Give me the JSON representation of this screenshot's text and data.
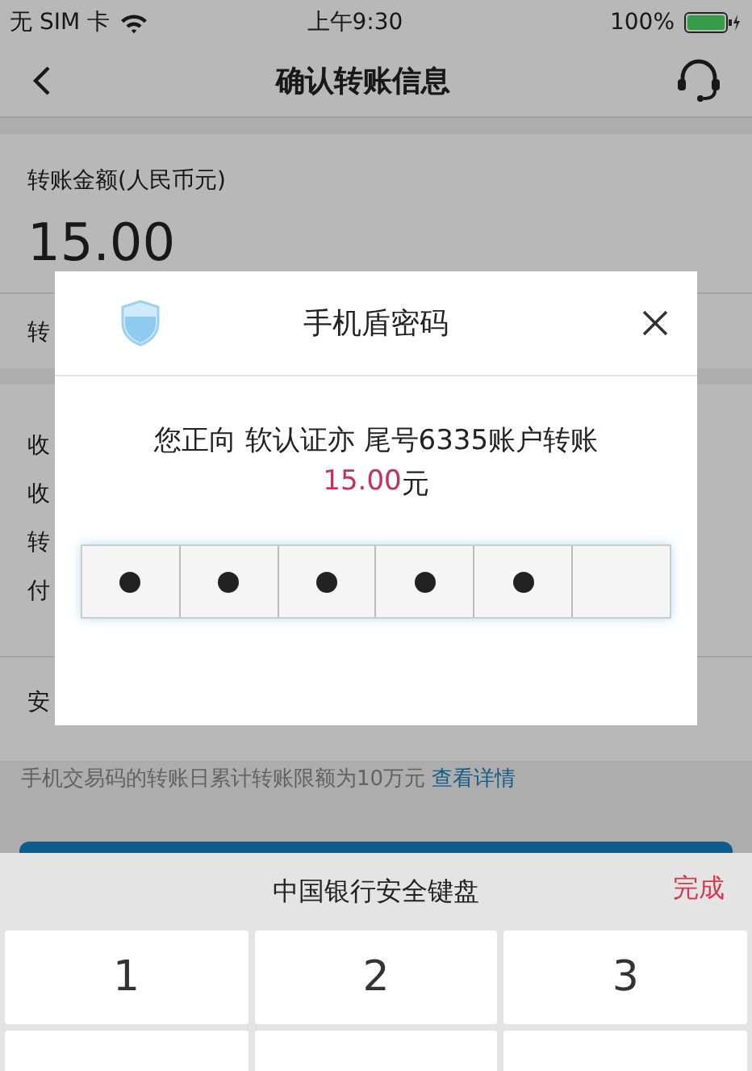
{
  "status_bar": {
    "carrier": "无 SIM 卡",
    "time": "上午9:30",
    "battery": "100%"
  },
  "nav": {
    "title": "确认转账信息"
  },
  "amount": {
    "label": "转账金额(人民币元)",
    "value": "15.00"
  },
  "section_1": [
    "转"
  ],
  "section_2": [
    "收",
    "收",
    "转",
    "付"
  ],
  "section_3": [
    "安"
  ],
  "note": {
    "text": "手机交易码的转账日累计转账限额为10万元",
    "link": "查看详情"
  },
  "dialog": {
    "title": "手机盾密码",
    "message": "您正向 软认证亦 尾号6335账户转账",
    "amount": "15.00",
    "unit": "元",
    "pin": [
      {
        "filled": true
      },
      {
        "filled": true
      },
      {
        "filled": true
      },
      {
        "filled": true
      },
      {
        "filled": true
      },
      {
        "filled": false
      }
    ]
  },
  "keyboard": {
    "title": "中国银行安全键盘",
    "done": "完成",
    "keys": [
      "1",
      "2",
      "3"
    ]
  }
}
